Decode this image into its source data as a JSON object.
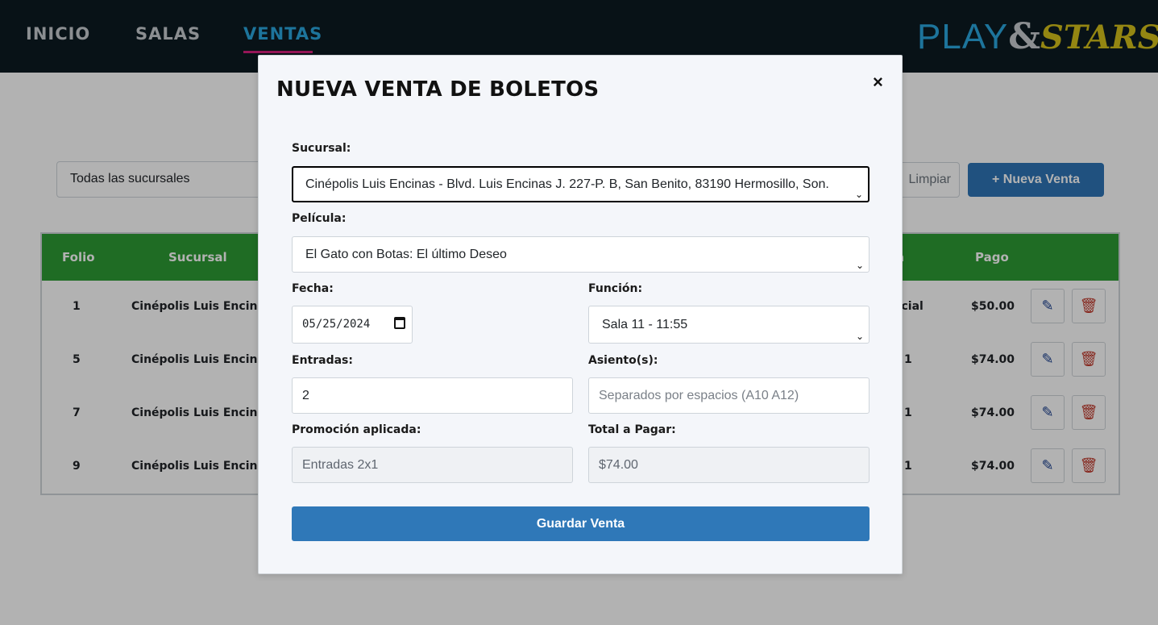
{
  "nav": {
    "items": [
      {
        "label": "INICIO"
      },
      {
        "label": "SALAS"
      },
      {
        "label": "VENTAS"
      }
    ],
    "logo": {
      "play": "PLAY",
      "amp": "&",
      "stars": "STARS"
    }
  },
  "page": {
    "filter_value": "Todas las sucursales",
    "limpiar_label": "Limpiar",
    "nueva_label": "+ Nueva Venta"
  },
  "table": {
    "headers": [
      "Folio",
      "Sucursal",
      "a",
      "Pago"
    ],
    "rows": [
      {
        "folio": "1",
        "sucursal": "Cinépolis Luis Encinas",
        "promo": "ecial",
        "pago": "$50.00"
      },
      {
        "folio": "5",
        "sucursal": "Cinépolis Luis Encinas",
        "promo": "1",
        "pago": "$74.00"
      },
      {
        "folio": "7",
        "sucursal": "Cinépolis Luis Encinas",
        "promo": "1",
        "pago": "$74.00"
      },
      {
        "folio": "9",
        "sucursal": "Cinépolis Luis Encinas",
        "promo": "1",
        "pago": "$74.00"
      }
    ]
  },
  "modal": {
    "title": "NUEVA VENTA DE BOLETOS",
    "close": "×",
    "sucursal_label": "Sucursal:",
    "sucursal_value": "Cinépolis Luis Encinas - Blvd. Luis Encinas J. 227-P. B, San Benito, 83190 Hermosillo, Son.",
    "pelicula_label": "Película:",
    "pelicula_value": "El Gato con Botas: El último Deseo",
    "fecha_label": "Fecha:",
    "fecha_value": "05/25/2024",
    "funcion_label": "Función:",
    "funcion_value": "Sala 11 - 11:55",
    "entradas_label": "Entradas:",
    "entradas_value": "2",
    "asientos_label": "Asiento(s):",
    "asientos_placeholder": "Separados por espacios (A10 A12)",
    "promo_label": "Promoción aplicada:",
    "promo_value": "Entradas 2x1",
    "total_label": "Total a Pagar:",
    "total_value": "$74.00",
    "save_label": "Guardar Venta"
  }
}
